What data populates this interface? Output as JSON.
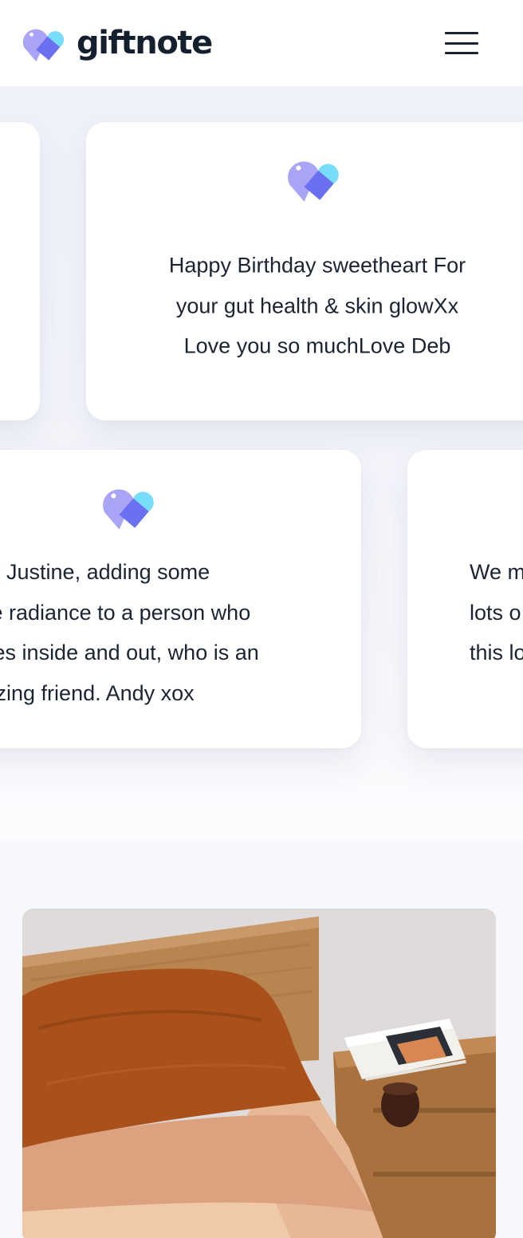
{
  "header": {
    "brand_name": "giftnote",
    "menu_icon": "hamburger-menu-icon"
  },
  "notes": [
    {
      "text": "Happy Birthday sweetheart For\nyour gut health & skin glowXx\nLove you so muchLove Deb"
    },
    {
      "text": "Dear Justine, adding some\nmore radiance to a person who\nshines inside and out, who is an\namazing friend. Andy xox"
    },
    {
      "text": "We m\nlots o\nthis lo"
    }
  ],
  "photo": {
    "description_icon": "bedroom-photo"
  },
  "colors": {
    "heart_left": "#a9a4f6",
    "heart_right": "#77ddfb",
    "heart_overlap": "#6a70ef",
    "brand_text": "#15202e"
  }
}
